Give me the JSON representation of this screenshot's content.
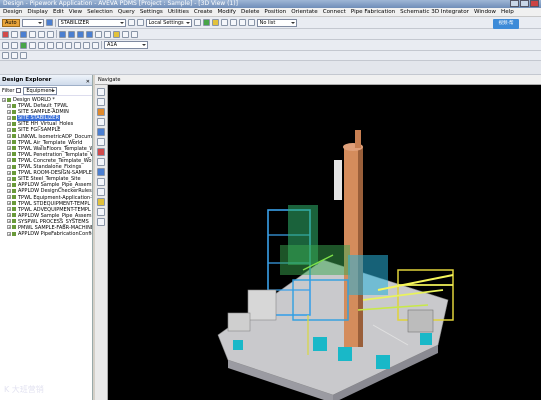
{
  "window": {
    "title": "Design - Pipework Application - AVEVA PDMS [Project : Sample] - [3D View (1)]"
  },
  "menu": [
    "Design",
    "Display",
    "Edit",
    "View",
    "Selection",
    "Query",
    "Settings",
    "Utilities",
    "Create",
    "Modify",
    "Delete",
    "Position",
    "Orientate",
    "Connect",
    "Pipe Fabrication",
    "Schematic 3D Integrator",
    "Window",
    "Help"
  ],
  "toolbar": {
    "auto_label": "Auto",
    "element_combo": "STABILIZER",
    "settings_combo": "Local Settings",
    "list_combo": "No list",
    "help_label": "视频·帮",
    "pos_combo": "A1A"
  },
  "explorer": {
    "title": "Design Explorer",
    "filter_label": "Filter",
    "filter_value": "Equipment",
    "items": [
      {
        "label": "Design WORLD *",
        "level": 0
      },
      {
        "label": "TPWL Default_TPWL",
        "level": 1
      },
      {
        "label": "SITE SAMPLE-ADMIN",
        "level": 1
      },
      {
        "label": "SITE STABILIZER",
        "level": 1,
        "selected": true
      },
      {
        "label": "SITE HH_Virtual_Holes",
        "level": 1
      },
      {
        "label": "SITE FGI-SAMPLE",
        "level": 1
      },
      {
        "label": "LINKWL IsometricADP_Documen",
        "level": 1
      },
      {
        "label": "TPWL Air_Template_World",
        "level": 1
      },
      {
        "label": "TPWL WallsFloors_Template_Wo",
        "level": 1
      },
      {
        "label": "TPWL Penetration_Template_Wor",
        "level": 1
      },
      {
        "label": "TPWL Concrete_Template_World",
        "level": 1
      },
      {
        "label": "TPWL Standalone_Fixings",
        "level": 1
      },
      {
        "label": "TPWL ROOM-DESIGN-SAMPLE",
        "level": 1
      },
      {
        "label": "SITE Steel_Template_Site",
        "level": 1
      },
      {
        "label": "APPLDW Sample_Pipe_Assembli",
        "level": 1
      },
      {
        "label": "APPLDW DesignCheckerRules",
        "level": 1
      },
      {
        "label": "TPWL Equipment-Application-Tem",
        "level": 1
      },
      {
        "label": "TPWL STDEQUIPMENT-TEMPL",
        "level": 1
      },
      {
        "label": "TPWL ADVEQUIPMENT-TEMPL",
        "level": 1
      },
      {
        "label": "APPLDW Sample_Pipe_Assembli",
        "level": 1
      },
      {
        "label": "SYSPWL PROCESS_SYSTEMS",
        "level": 1
      },
      {
        "label": "PMWL SAMPLE-FABR-MACHINE",
        "level": 1
      },
      {
        "label": "APPLDW PipeFabricationConfig",
        "level": 1
      }
    ]
  },
  "view": {
    "tab_label": "Navigate"
  },
  "watermark": "K 大班营销"
}
